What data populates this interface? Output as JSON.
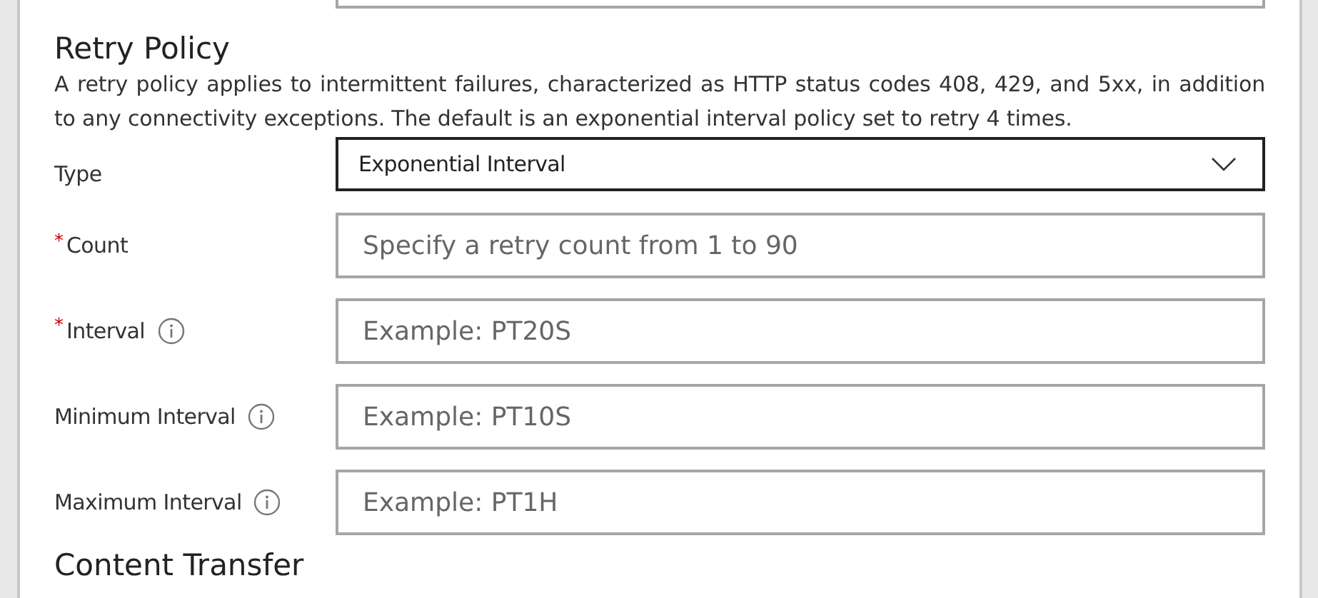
{
  "section": {
    "title": "Retry Policy",
    "description": "A retry policy applies to intermittent failures, characterized as HTTP status codes 408, 429, and 5xx, in addition to any connectivity exceptions. The default is an exponential interval policy set to retry 4 times."
  },
  "fields": [
    {
      "kind": "dropdown",
      "label": "Type",
      "info": false,
      "value": "Exponential Interval"
    },
    {
      "kind": "text",
      "required_mark": "*",
      "label": "Count",
      "info": false,
      "placeholder": "Specify a retry count from 1 to 90"
    },
    {
      "kind": "text",
      "required_mark": "*",
      "label": "Interval",
      "info": true,
      "placeholder": "Example: PT20S"
    },
    {
      "kind": "text",
      "label": "Minimum Interval",
      "info": true,
      "placeholder": "Example: PT10S"
    },
    {
      "kind": "text",
      "label": "Maximum Interval",
      "info": true,
      "placeholder": "Example: PT1H"
    }
  ],
  "next_section": {
    "title": "Content Transfer"
  }
}
